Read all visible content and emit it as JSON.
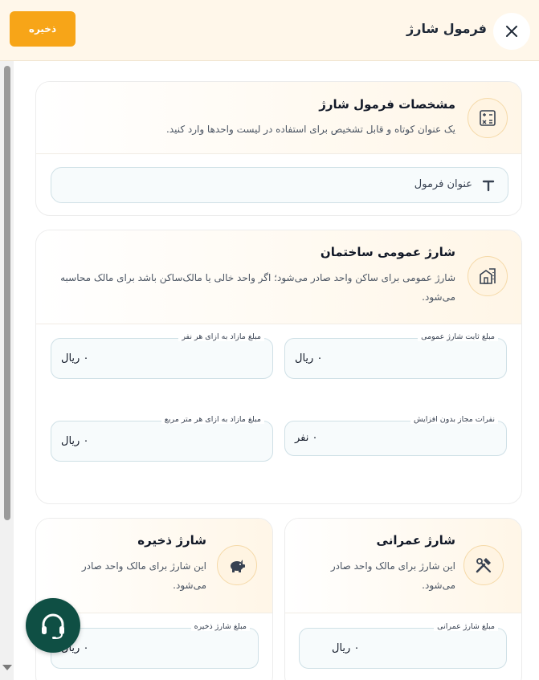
{
  "header": {
    "title": "فرمول شارژ",
    "save_label": "ذخیره",
    "close_icon": "close-icon"
  },
  "colors": {
    "accent": "#f7a518",
    "header_bg": "#fff7ea",
    "help_button": "#0f4f44"
  },
  "spec_card": {
    "title": "مشخصات فرمول شارژ",
    "description": "یک عنوان کوتاه و قابل تشخیص برای استفاده در لیست واحدها وارد کنید.",
    "icon": "calculator-icon",
    "title_placeholder": "عنوان فرمول",
    "field_icon": "text-t-icon"
  },
  "public_card": {
    "title": "شارژ عمومی ساختمان",
    "description": "شارژ عمومی برای ساکن واحد صادر می‌شود؛ اگر واحد خالی یا مالک‌ساکن باشد برای مالک محاسبه می‌شود.",
    "icon": "building-icon",
    "fields": {
      "fixed": {
        "label": "مبلغ ثابت شارژ عمومی",
        "value": "۰ ریال"
      },
      "per_person": {
        "label": "مبلغ مازاد به ازای هر نفر",
        "value": "۰ ریال"
      },
      "free_persons": {
        "label": "نفرات مجاز بدون افزایش",
        "value": "۰ نفر"
      },
      "per_sqm": {
        "label": "مبلغ مازاد به ازای هر متر مربع",
        "value": "۰ ریال"
      }
    }
  },
  "construction_card": {
    "title": "شارژ عمرانی",
    "description": "این شارژ برای مالک واحد صادر می‌شود.",
    "icon": "tools-icon",
    "field": {
      "label": "مبلغ شارژ عمرانی",
      "value": "۰ ریال"
    }
  },
  "reserve_card": {
    "title": "شارژ ذخیره",
    "description": "این شارژ برای مالک واحد صادر می‌شود.",
    "icon": "piggy-bank-icon",
    "field": {
      "label": "مبلغ شارژ ذخیره",
      "value": "۰ ریال"
    }
  },
  "support": {
    "icon": "headset-icon"
  }
}
